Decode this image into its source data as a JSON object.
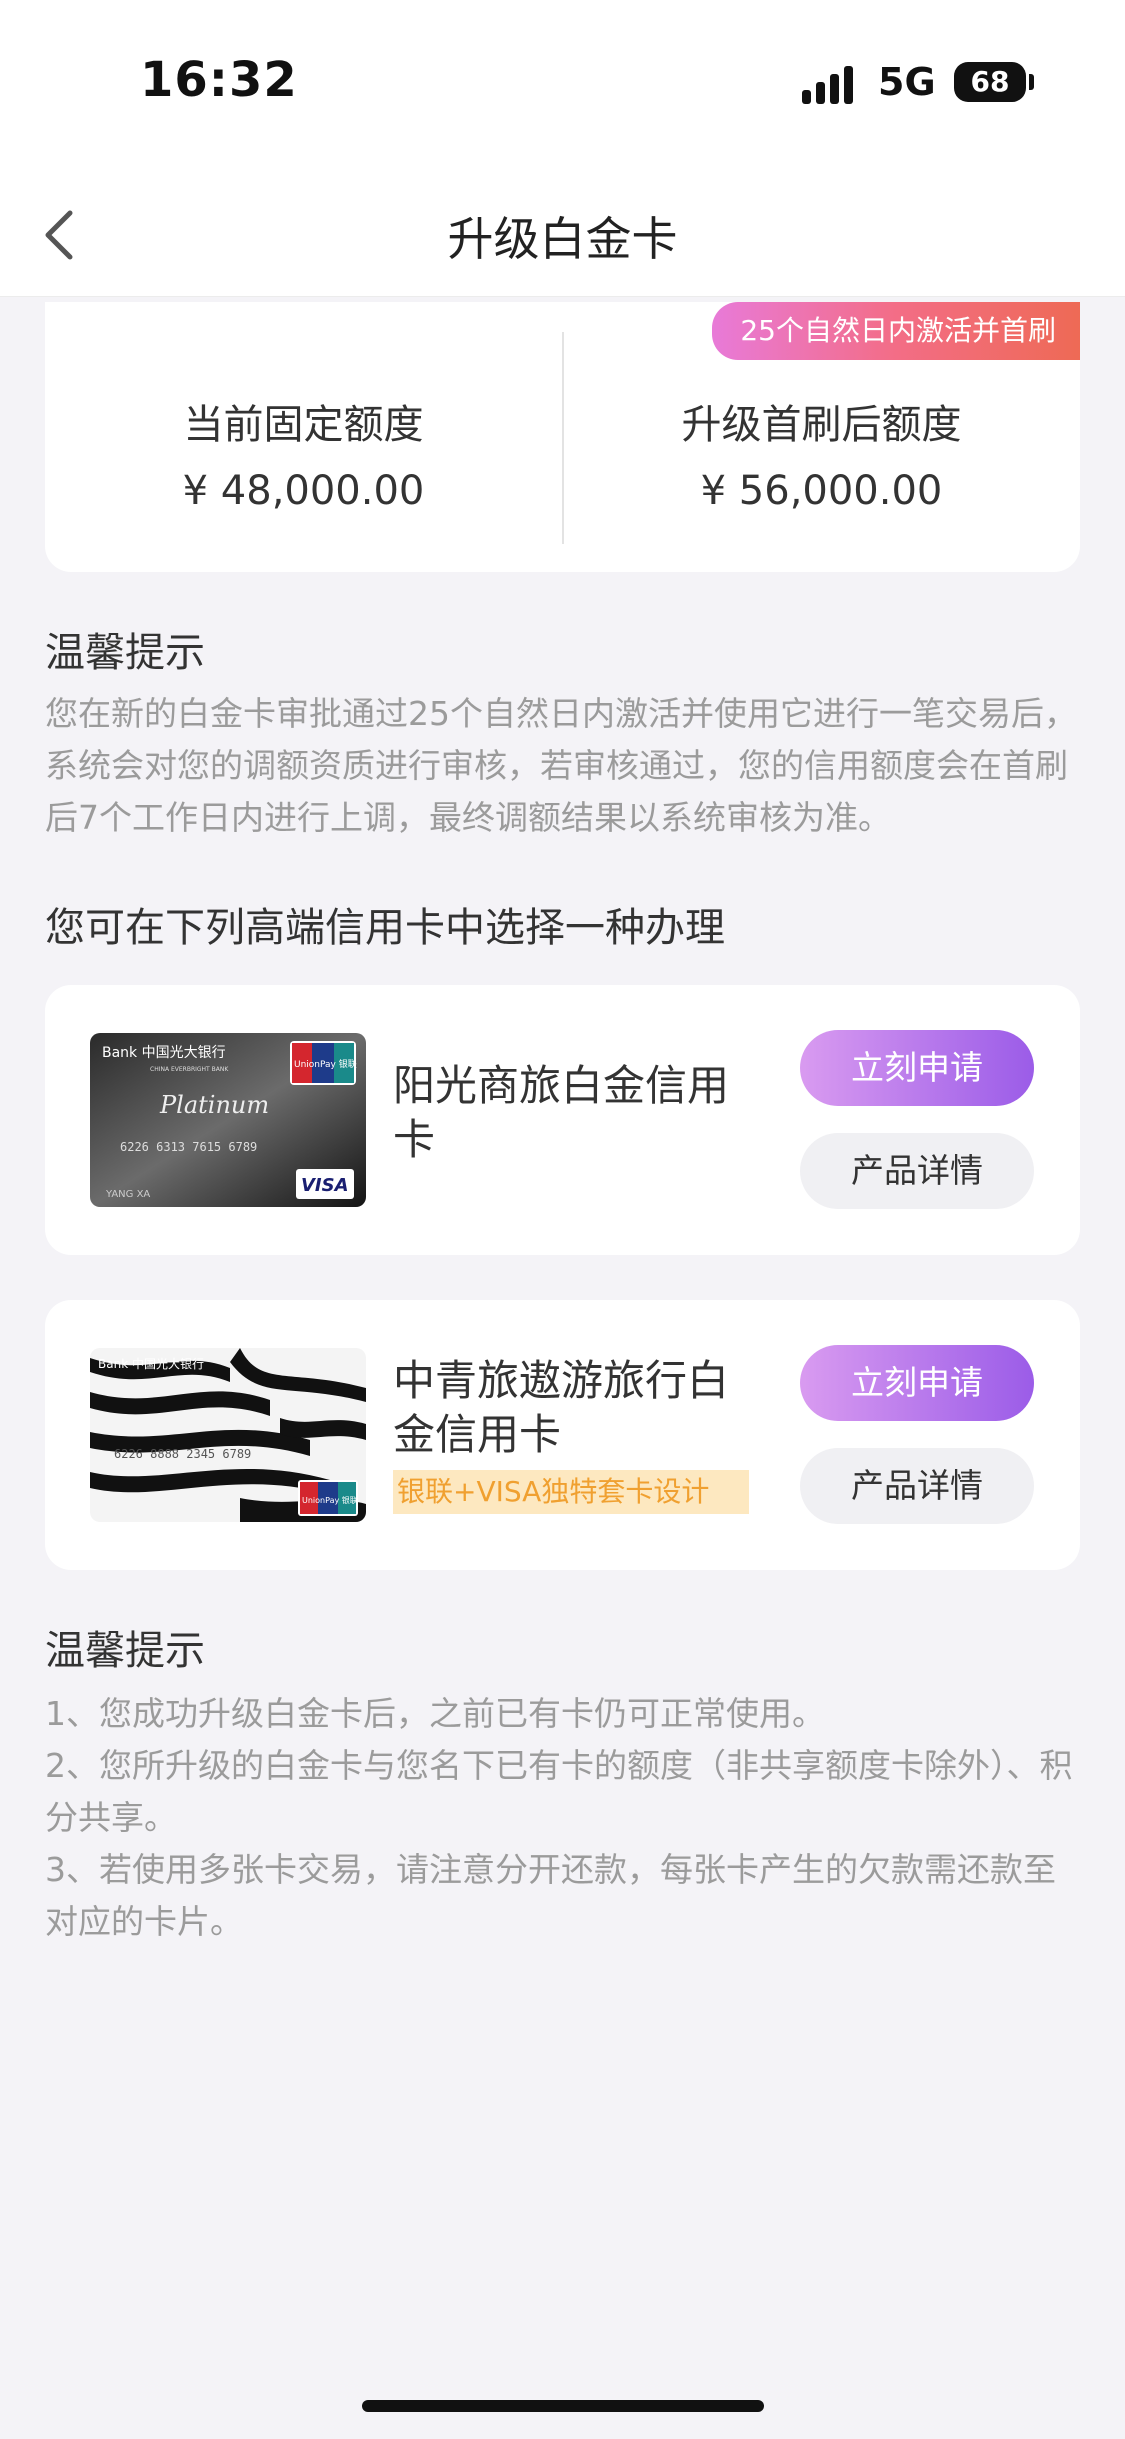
{
  "status_bar": {
    "time": "16:32",
    "network": "5G",
    "battery": "68"
  },
  "nav": {
    "title": "升级白金卡"
  },
  "quota": {
    "badge": "25个自然日内激活并首刷",
    "current_label": "当前固定额度",
    "current_value": "¥ 48,000.00",
    "upgrade_label": "升级首刷后额度",
    "upgrade_value": "¥ 56,000.00"
  },
  "tip1": {
    "title": "温馨提示",
    "text": "您在新的白金卡审批通过25个自然日内激活并使用它进行一笔交易后，系统会对您的调额资质进行审核，若审核通过，您的信用额度会在首刷后7个工作日内进行上调，最终调额结果以系统审核为准。"
  },
  "choose_title": "您可在下列高端信用卡中选择一种办理",
  "products": [
    {
      "name": "阳光商旅白金信用卡",
      "apply_label": "立刻申请",
      "detail_label": "产品详情",
      "card_text": {
        "bank": "Bank 中国光大银行",
        "bank_en": "CHINA EVERBRIGHT BANK",
        "series": "Platinum",
        "number": "6226 6313 7615 6789",
        "holder": "YANG XA",
        "unionpay": "UnionPay 银联",
        "visa": "VISA"
      }
    },
    {
      "name": "中青旅遨游旅行白金信用卡",
      "tag": "银联+VISA独特套卡设计",
      "apply_label": "立刻申请",
      "detail_label": "产品详情",
      "card_text": {
        "bank": "Bank 中国光大银行",
        "number": "6226 8888 2345 6789",
        "unionpay": "UnionPay 银联"
      }
    }
  ],
  "tip2": {
    "title": "温馨提示",
    "items": [
      "1、您成功升级白金卡后，之前已有卡仍可正常使用。",
      "2、您所升级的白金卡与您名下已有卡的额度（非共享额度卡除外）、积分共享。",
      "3、若使用多张卡交易，请注意分开还款，每张卡产生的欠款需还款至对应的卡片。"
    ]
  },
  "colors": {
    "accent_start": "#d99bf0",
    "accent_end": "#9b5ce8",
    "badge_start": "#e87ad8",
    "badge_end": "#ee6a55",
    "tag_bg": "#fde8c0",
    "tag_text": "#f0a030"
  },
  "icons": {
    "back": "chevron-left-icon",
    "signal": "cellular-signal-icon",
    "battery": "battery-icon"
  }
}
